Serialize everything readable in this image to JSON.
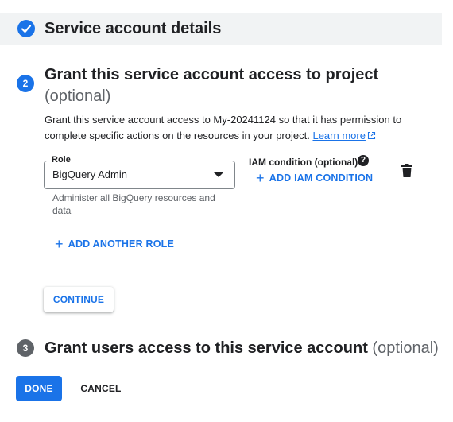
{
  "step1": {
    "title": "Service account details",
    "status_icon": "check-icon"
  },
  "step2": {
    "number": "2",
    "title": "Grant this service account access to project",
    "optional": "(optional)",
    "description": "Grant this service account access to My-20241124 so that it has permission to complete specific actions on the resources in your project.",
    "learn_more": "Learn more",
    "role": {
      "label": "Role",
      "value": "BigQuery Admin",
      "helper": "Administer all BigQuery resources and data"
    },
    "iam_condition": {
      "label": "IAM condition (optional)",
      "help_icon": "question-mark-icon",
      "add_label": "ADD IAM CONDITION"
    },
    "delete_icon": "trash-icon",
    "add_another_role": "ADD ANOTHER ROLE",
    "continue_label": "CONTINUE"
  },
  "step3": {
    "number": "3",
    "title": "Grant users access to this service account",
    "optional": "(optional)"
  },
  "footer": {
    "done_label": "DONE",
    "cancel_label": "CANCEL"
  },
  "colors": {
    "accent": "#1a73e8",
    "inactive_step": "#5f6368",
    "header_bg": "#f1f3f4"
  }
}
